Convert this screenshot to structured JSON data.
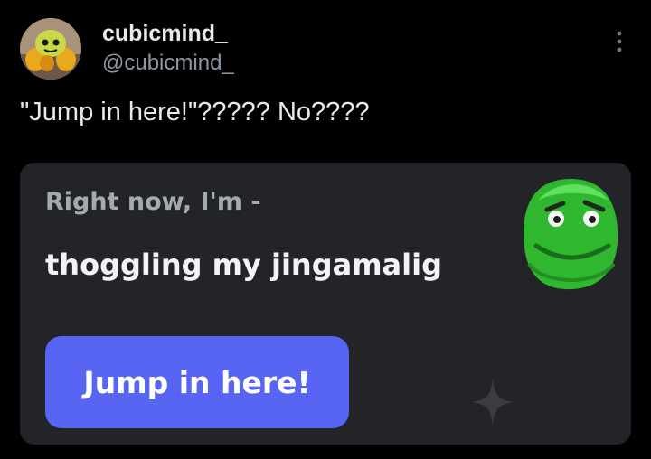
{
  "post": {
    "author": {
      "display_name": "cubicmind_",
      "handle": "@cubicmind_",
      "avatar_icon": "avatar-character"
    },
    "more_icon": "more-vertical-icon",
    "text": "\"Jump in here!\"????? No????"
  },
  "card": {
    "status_label": "Right now, I'm -",
    "activity": "thoggling my jingamalig",
    "button_label": "Jump in here!",
    "activity_icon": "green-face-icon",
    "decoration_icon": "sparkle-icon"
  },
  "colors": {
    "background": "#000000",
    "card_background": "#232428",
    "button_accent": "#5865f2",
    "handle_text": "#8b98a5",
    "label_text": "#a5a9b1",
    "activity_green": "#2fb82f"
  }
}
